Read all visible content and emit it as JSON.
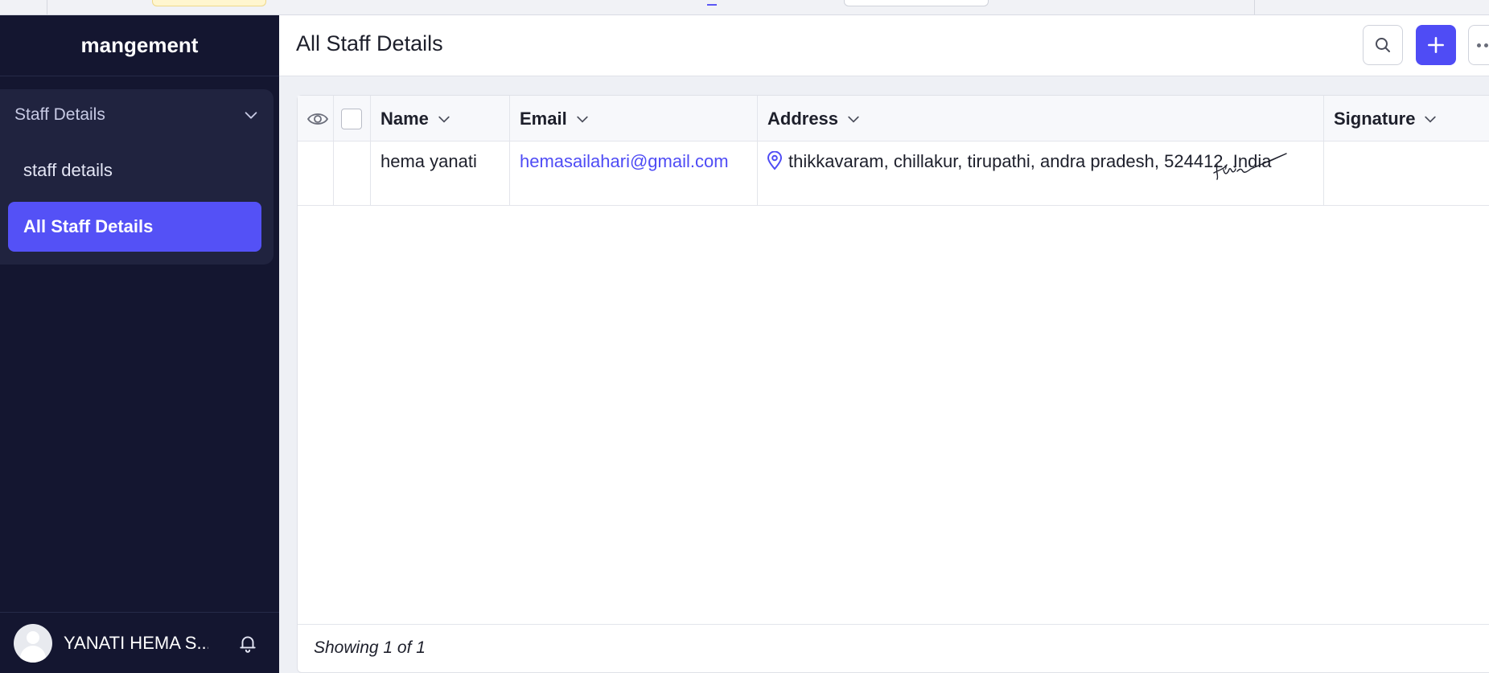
{
  "colors": {
    "sidebar_bg": "#141630",
    "accent": "#5451f6",
    "link": "#4f4cf5"
  },
  "sidebar": {
    "brand": "mangement",
    "group": {
      "label": "Staff Details",
      "icon": "chevron-down-icon",
      "items": [
        {
          "label": "staff details",
          "active": false
        },
        {
          "label": "All Staff Details",
          "active": true
        }
      ]
    },
    "user": {
      "name": "YANATI HEMA S...",
      "avatar_icon": "user-avatar",
      "bell_icon": "bell-icon"
    }
  },
  "header": {
    "title": "All Staff Details",
    "actions": [
      {
        "name": "search",
        "icon": "search-icon"
      },
      {
        "name": "add",
        "icon": "plus-icon"
      },
      {
        "name": "more",
        "icon": "more-icon"
      }
    ]
  },
  "table": {
    "columns": [
      "Name",
      "Email",
      "Address",
      "Signature"
    ],
    "rows": [
      {
        "name": "hema yanati",
        "email": "hemasailahari@gmail.com",
        "address": "thikkavaram, chillakur, tirupathi, andra pradesh, 524412, India",
        "signature": "handwritten-signature-image"
      }
    ],
    "footer": "Showing 1 of 1"
  }
}
